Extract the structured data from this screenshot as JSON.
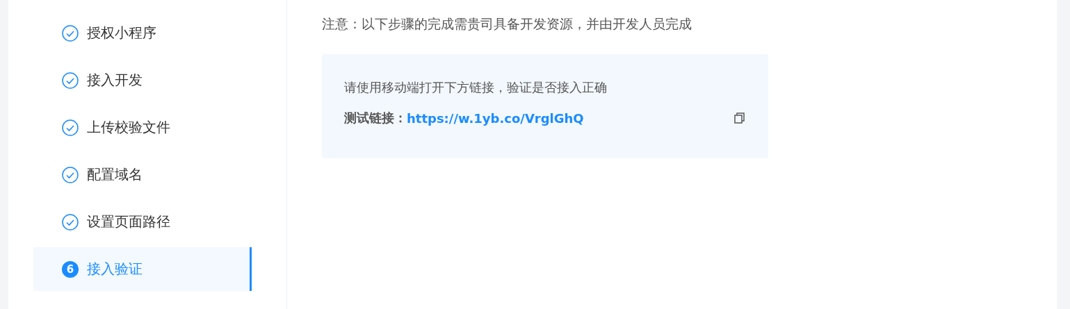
{
  "steps": [
    {
      "label": "授权小程序",
      "completed": true,
      "selected": false
    },
    {
      "label": "接入开发",
      "completed": true,
      "selected": false
    },
    {
      "label": "上传校验文件",
      "completed": true,
      "selected": false
    },
    {
      "label": "配置域名",
      "completed": true,
      "selected": false
    },
    {
      "label": "设置页面路径",
      "completed": true,
      "selected": false
    },
    {
      "label": "接入验证",
      "completed": false,
      "selected": true,
      "number": "6"
    }
  ],
  "notice": "注意：以下步骤的完成需贵司具备开发资源，并由开发人员完成",
  "verify_card": {
    "instruction": "请使用移动端打开下方链接，验证是否接入正确",
    "link_label": "测试链接：",
    "link": "https://w.1yb.co/VrglGhQ"
  }
}
